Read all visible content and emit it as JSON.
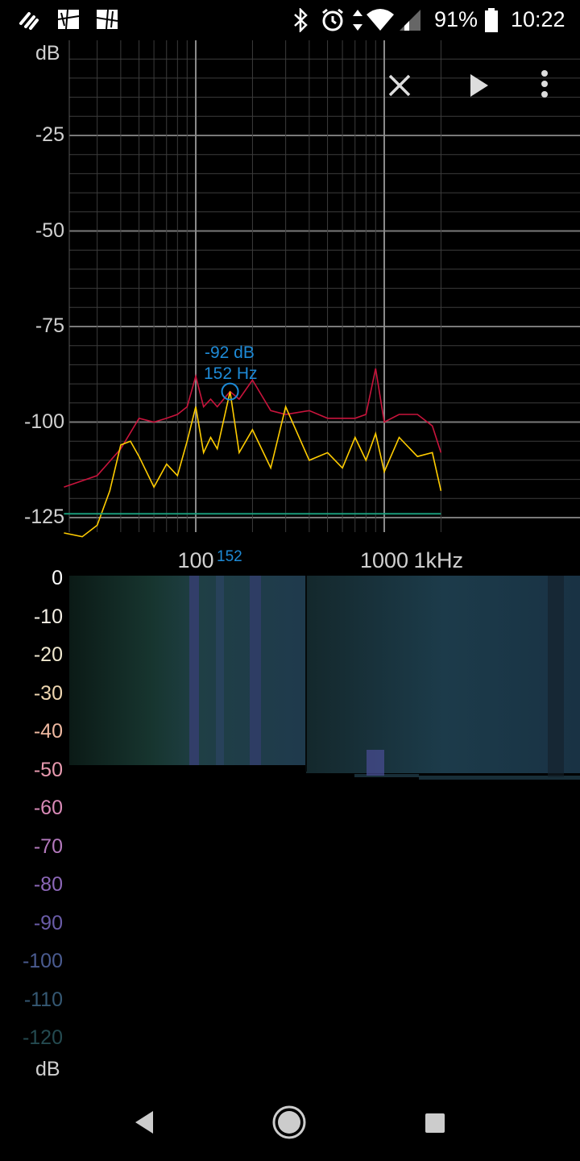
{
  "status_bar": {
    "battery": "91%",
    "time": "10:22",
    "icons": [
      "app-notification-icon",
      "image-icon",
      "image-icon",
      "bluetooth-icon",
      "alarm-icon",
      "data-arrows-icon",
      "wifi-icon",
      "signal-icon",
      "battery-icon"
    ]
  },
  "toolbar": {
    "icons": [
      "close-icon",
      "play-icon",
      "more-vert-icon"
    ]
  },
  "spectrum": {
    "unit_label": "dB",
    "y_ticks": [
      "-25",
      "-50",
      "-75",
      "-100",
      "-125"
    ],
    "x_ticks": [
      "100",
      "1000",
      "1kHz"
    ],
    "cursor": {
      "db": "-92 dB",
      "hz": "152 Hz",
      "axis_marker": "152"
    },
    "colors": {
      "peak": "#c8143c",
      "live": "#ffcc00",
      "noise_floor": "#1a9a7a",
      "cursor": "#1e8ad6"
    }
  },
  "chart_data": {
    "type": "line",
    "xscale": "log",
    "xlim": [
      20,
      2000
    ],
    "ylim": [
      -130,
      0
    ],
    "ylabel": "dB",
    "series": [
      {
        "x": [
          20,
          30,
          40,
          50,
          60,
          70,
          80,
          90,
          100,
          110,
          120,
          130,
          152,
          170,
          200,
          250,
          300,
          400,
          500,
          600,
          700,
          800,
          900,
          1000,
          1200,
          1500,
          1800,
          2000
        ],
        "y": [
          -117,
          -114,
          -107,
          -99,
          -100,
          -99,
          -98,
          -96,
          -88,
          -96,
          -94,
          -96,
          -92,
          -94,
          -89,
          -97,
          -98,
          -97,
          -99,
          -99,
          -99,
          -98,
          -86,
          -100,
          -98,
          -98,
          -101,
          -108
        ]
      },
      {
        "x": [
          20,
          25,
          30,
          35,
          40,
          45,
          50,
          60,
          70,
          80,
          90,
          100,
          110,
          120,
          130,
          152,
          170,
          200,
          250,
          300,
          400,
          500,
          600,
          700,
          800,
          900,
          1000,
          1200,
          1500,
          1800,
          2000
        ],
        "y": [
          -129,
          -130,
          -127,
          -118,
          -106,
          -105,
          -109,
          -117,
          -111,
          -114,
          -105,
          -96,
          -108,
          -104,
          -107,
          -92,
          -108,
          -102,
          -112,
          -96,
          -110,
          -108,
          -112,
          -104,
          -110,
          -103,
          -113,
          -104,
          -109,
          -108,
          -118
        ]
      },
      {
        "x": [
          20,
          2000
        ],
        "y": [
          -124,
          -124
        ]
      }
    ]
  },
  "spectrogram": {
    "scale": [
      "0",
      "-10",
      "-20",
      "-30",
      "-40",
      "-50",
      "-60",
      "-70",
      "-80",
      "-90",
      "-100",
      "-110",
      "-120"
    ],
    "scale_colors": [
      "#ffffff",
      "#f5f0e6",
      "#efe8cf",
      "#eed6b0",
      "#eeb8a0",
      "#e89ab0",
      "#d98ab7",
      "#b479bd",
      "#8c67b8",
      "#6a5ca8",
      "#4a5b90",
      "#355873",
      "#244a50"
    ],
    "unit_label": "dB"
  },
  "navbar": {
    "icons": [
      "back-icon",
      "home-icon",
      "recents-icon"
    ]
  }
}
